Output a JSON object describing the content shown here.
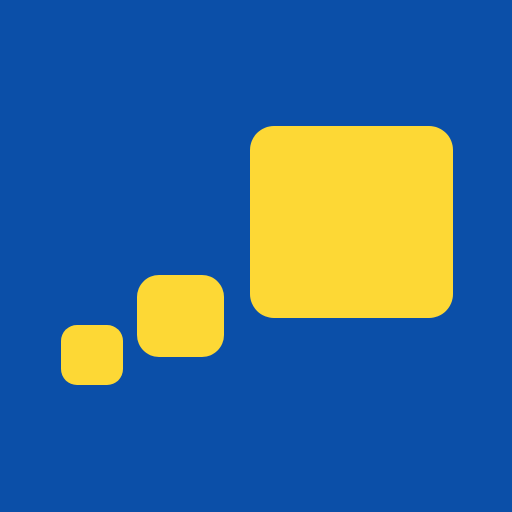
{
  "logo": {
    "name": "tile-logo",
    "colors": {
      "background": "#0b4fa8",
      "accent": "#fdd835"
    },
    "shapes": [
      "small-square",
      "medium-square",
      "large-square"
    ]
  }
}
